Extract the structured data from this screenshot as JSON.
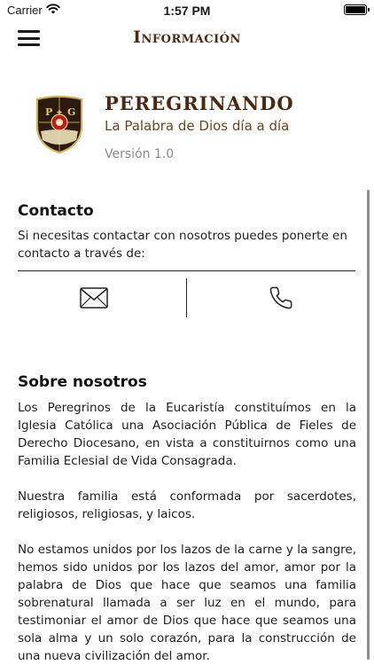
{
  "status_bar": {
    "carrier": "Carrier",
    "time": "1:57 PM",
    "wifi_icon": "wifi-icon",
    "battery_icon": "battery-icon"
  },
  "nav": {
    "title": "Información",
    "menu_icon": "hamburger-menu-icon"
  },
  "app": {
    "name": "PEREGRINANDO",
    "tagline": "La Palabra de Dios día a día",
    "version": "Versión 1.0",
    "logo_letters": [
      "P",
      "G"
    ],
    "colors": {
      "brand": "#4a2a14",
      "gold": "#c79b3c"
    }
  },
  "contact": {
    "title": "Contacto",
    "text": "Si necesitas contactar con nosotros puedes ponerte en contacto a través de:",
    "email_icon": "envelope-icon",
    "phone_icon": "phone-icon"
  },
  "about": {
    "title": "Sobre nosotros",
    "paragraphs": [
      "Los Peregrinos de la Eucaristía constituímos en la Iglesia Católica una Asociación Pública de Fieles de Derecho Diocesano, en vista a constituirnos como una Familia Eclesial de Vida Consagrada.",
      "Nuestra familia está conformada por sacerdotes, religiosos, religiosas, y laicos.",
      "No estamos unidos por los lazos de la carne y la sangre, hemos sido unidos por los lazos del amor, amor por la palabra de Dios que hace que seamos una familia sobrenatural llamada a ser luz en el mundo, para testimoniar el amor de Dios que hace que seamos una sola alma y un solo corazón, para la construcción de una nueva civilización del amor."
    ]
  }
}
